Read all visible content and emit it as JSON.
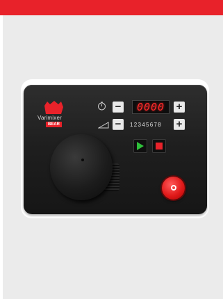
{
  "header": {
    "accent_color": "#e8222a"
  },
  "panel": {
    "brand": {
      "name": "Varimixer",
      "sub": "BEAR",
      "logo_icon": "bear-logo-icon"
    },
    "timer": {
      "icon": "stopwatch-icon",
      "minus_label": "−",
      "plus_label": "+",
      "display_value": "0000"
    },
    "speed": {
      "icon": "ramp-icon",
      "minus_label": "−",
      "plus_label": "+",
      "steps": "12345678"
    },
    "controls": {
      "start_icon": "play-icon",
      "stop_icon": "stop-icon"
    },
    "emergency_icon": "emergency-stop-icon",
    "knob_icon": "bowl-lift-knob"
  }
}
